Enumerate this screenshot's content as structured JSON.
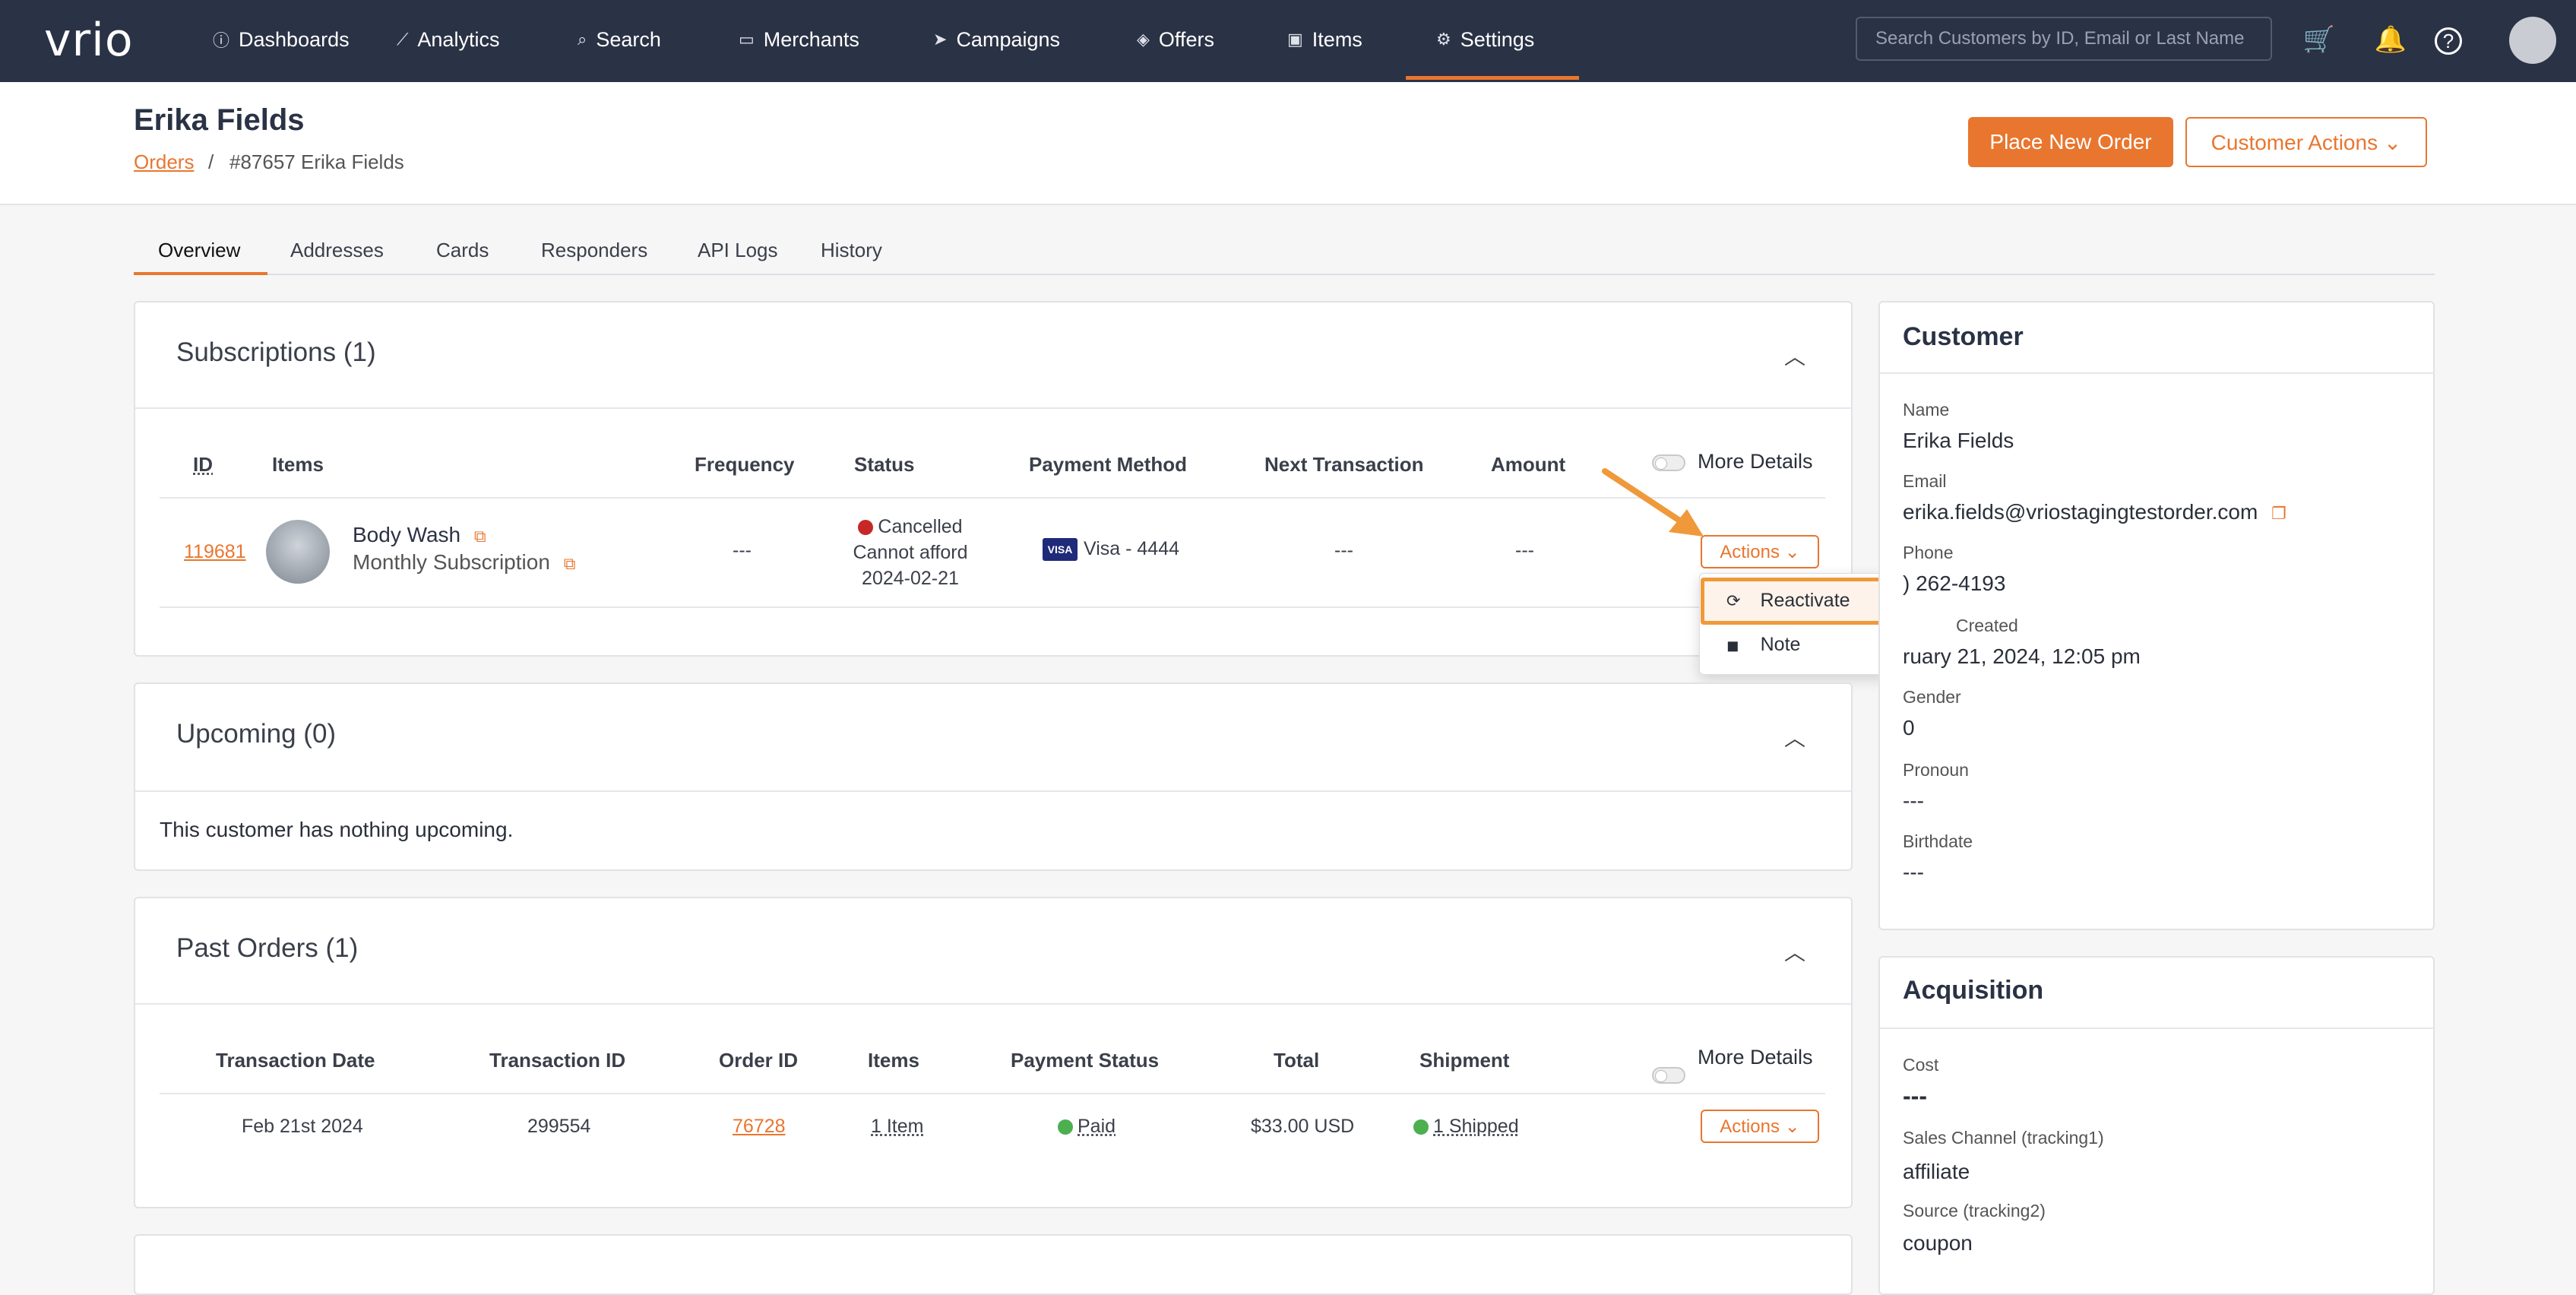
{
  "app": {
    "logo": "vrio"
  },
  "nav": {
    "items": [
      {
        "label": "Dashboards",
        "icon": "ⓘ"
      },
      {
        "label": "Analytics",
        "icon": "⟋"
      },
      {
        "label": "Search",
        "icon": "⌕"
      },
      {
        "label": "Merchants",
        "icon": "▭"
      },
      {
        "label": "Campaigns",
        "icon": "➤"
      },
      {
        "label": "Offers",
        "icon": "◈"
      },
      {
        "label": "Items",
        "icon": "▣"
      },
      {
        "label": "Settings",
        "icon": "⚙"
      }
    ],
    "search_placeholder": "Search Customers by ID, Email or Last Name",
    "cart_icon": "🛒",
    "bell_icon": "🔔",
    "help_icon": "?"
  },
  "header": {
    "title": "Erika Fields",
    "breadcrumb_link": "Orders",
    "breadcrumb_sep": "/",
    "breadcrumb_current": "#87657 Erika Fields",
    "place_order": "Place New Order",
    "customer_actions": "Customer Actions ⌄"
  },
  "tabs": [
    "Overview",
    "Addresses",
    "Cards",
    "Responders",
    "API Logs",
    "History"
  ],
  "subscriptions": {
    "title": "Subscriptions (1)",
    "more_details": "More Details",
    "headers": [
      "ID",
      "Items",
      "Frequency",
      "Status",
      "Payment Method",
      "Next Transaction",
      "Amount"
    ],
    "row": {
      "id": "119681",
      "item_name": "Body Wash",
      "item_sub": "Monthly Subscription",
      "frequency": "---",
      "status": "Cancelled",
      "status_reason": "Cannot afford",
      "status_date": "2024-02-21",
      "payment_badge": "VISA",
      "payment": "Visa - 4444",
      "next_transaction": "---",
      "amount": "---",
      "actions": "Actions ⌄"
    }
  },
  "dropdown": {
    "items": [
      "Reactivate",
      "Note"
    ]
  },
  "upcoming": {
    "title": "Upcoming (0)",
    "empty": "This customer has nothing upcoming."
  },
  "past_orders": {
    "title": "Past Orders (1)",
    "more_details": "More Details",
    "headers": [
      "Transaction Date",
      "Transaction ID",
      "Order ID",
      "Items",
      "Payment Status",
      "Total",
      "Shipment"
    ],
    "row": {
      "date": "Feb 21st 2024",
      "transaction_id": "299554",
      "order_id": "76728",
      "items": "1 Item",
      "payment_status": "Paid",
      "total": "$33.00 USD",
      "shipment": "1 Shipped",
      "actions": "Actions ⌄"
    }
  },
  "customer": {
    "title": "Customer",
    "fields": [
      {
        "label": "Name",
        "value": "Erika Fields"
      },
      {
        "label": "Email",
        "value": "erika.fields@vriostagingtestorder.com"
      },
      {
        "label": "Phone",
        "value": ") 262-4193"
      },
      {
        "label": "Created",
        "value": "ruary 21, 2024, 12:05 pm"
      },
      {
        "label": "Gender",
        "value": "0"
      },
      {
        "label": "Pronoun",
        "value": "---"
      },
      {
        "label": "Birthdate",
        "value": "---"
      }
    ]
  },
  "acquisition": {
    "title": "Acquisition",
    "fields": [
      {
        "label": "Cost",
        "value": "---"
      },
      {
        "label": "Sales Channel (tracking1)",
        "value": "affiliate"
      },
      {
        "label": "Source (tracking2)",
        "value": "coupon"
      }
    ]
  },
  "colors": {
    "nav_bg": "#2a3245",
    "accent": "#e8762f",
    "cancelled": "#c62828",
    "paid": "#4caf50"
  }
}
